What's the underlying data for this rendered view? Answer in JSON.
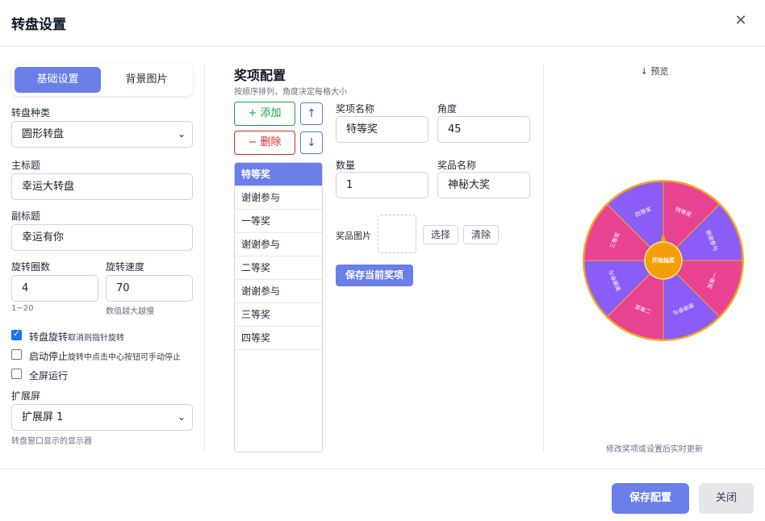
{
  "dialog": {
    "title": "转盘设置",
    "close_icon": "close-icon"
  },
  "tabs": [
    {
      "label": "基础设置",
      "active": true
    },
    {
      "label": "背景图片",
      "active": false
    }
  ],
  "left": {
    "wheel_type_label": "转盘种类",
    "wheel_type_value": "圆形转盘",
    "main_title_label": "主标题",
    "main_title_value": "幸运大转盘",
    "sub_title_label": "副标题",
    "sub_title_value": "幸运有你",
    "rounds_label": "旋转圈数",
    "rounds_value": "4",
    "rounds_hint": "1~20",
    "speed_label": "旋转速度",
    "speed_value": "70",
    "speed_hint": "数值越大越慢",
    "opt_rotate_main": "转盘旋转",
    "opt_rotate_note": "取消则指针旋转",
    "opt_rotate_checked": true,
    "opt_stop_main": "启动停止",
    "opt_stop_note": "旋转中点击中心按钮可手动停止",
    "opt_stop_checked": false,
    "opt_fullscreen": "全屏运行",
    "opt_fullscreen_checked": false,
    "ext_label": "扩展屏",
    "ext_value": "扩展屏 1",
    "ext_hint": "转盘窗口显示的显示器"
  },
  "prizes": {
    "title": "奖项配置",
    "subtitle": "按顺序排列，角度决定每格大小",
    "add_label": "+ 添加",
    "delete_label": "− 删除",
    "up_label": "↑",
    "down_label": "↓",
    "items": [
      "特等奖",
      "谢谢参与",
      "一等奖",
      "谢谢参与",
      "二等奖",
      "谢谢参与",
      "三等奖",
      "四等奖"
    ],
    "selected_index": 0,
    "name_label": "奖项名称",
    "name_value": "特等奖",
    "angle_label": "角度",
    "angle_value": "45",
    "qty_label": "数量",
    "qty_value": "1",
    "prize_name_label": "奖品名称",
    "prize_name_value": "神秘大奖",
    "image_label": "奖品图片",
    "choose_label": "选择",
    "clear_label": "清除",
    "save_item_label": "保存当前奖项"
  },
  "preview": {
    "title": "↓ 预览",
    "center_label": "开始抽奖",
    "note": "修改奖项或设置后实时更新",
    "segments": [
      {
        "label": "特等奖",
        "color": "#e84393"
      },
      {
        "label": "谢谢参与",
        "color": "#8b5cf6"
      },
      {
        "label": "一等奖",
        "color": "#e84393"
      },
      {
        "label": "谢谢参与",
        "color": "#8b5cf6"
      },
      {
        "label": "二等奖",
        "color": "#e84393"
      },
      {
        "label": "谢谢参与",
        "color": "#8b5cf6"
      },
      {
        "label": "三等奖",
        "color": "#e84393"
      },
      {
        "label": "四等奖",
        "color": "#8b5cf6"
      }
    ],
    "rim_color": "#f5a623",
    "center_color": "#f59e0b"
  },
  "footer": {
    "save_label": "保存配置",
    "close_label": "关闭"
  },
  "colors": {
    "accent": "#6b7fe8",
    "add_green": "#16a34a",
    "delete_red": "#dc2626"
  }
}
